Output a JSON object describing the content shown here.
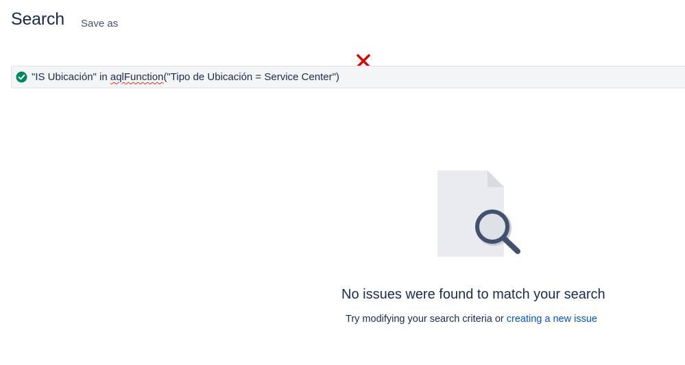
{
  "header": {
    "title": "Search",
    "save_as_label": "Save as"
  },
  "query_bar": {
    "status": "valid",
    "status_color": "#00875a",
    "text_before_function": "\"IS Ubicación\" in ",
    "function_name": "aqlFunction",
    "text_after_function": "(\"Tipo de Ubicación = Service Center\")",
    "error_marker_color": "#de350b"
  },
  "empty_state": {
    "illustration": "document-search-icon",
    "title": "No issues were found to match your search",
    "subtitle_prefix": "Try modifying your search criteria or ",
    "link_label": "creating a new issue",
    "link_color": "#0052cc"
  },
  "overlay": {
    "icon": "red-x-icon",
    "color": "#e00000"
  }
}
